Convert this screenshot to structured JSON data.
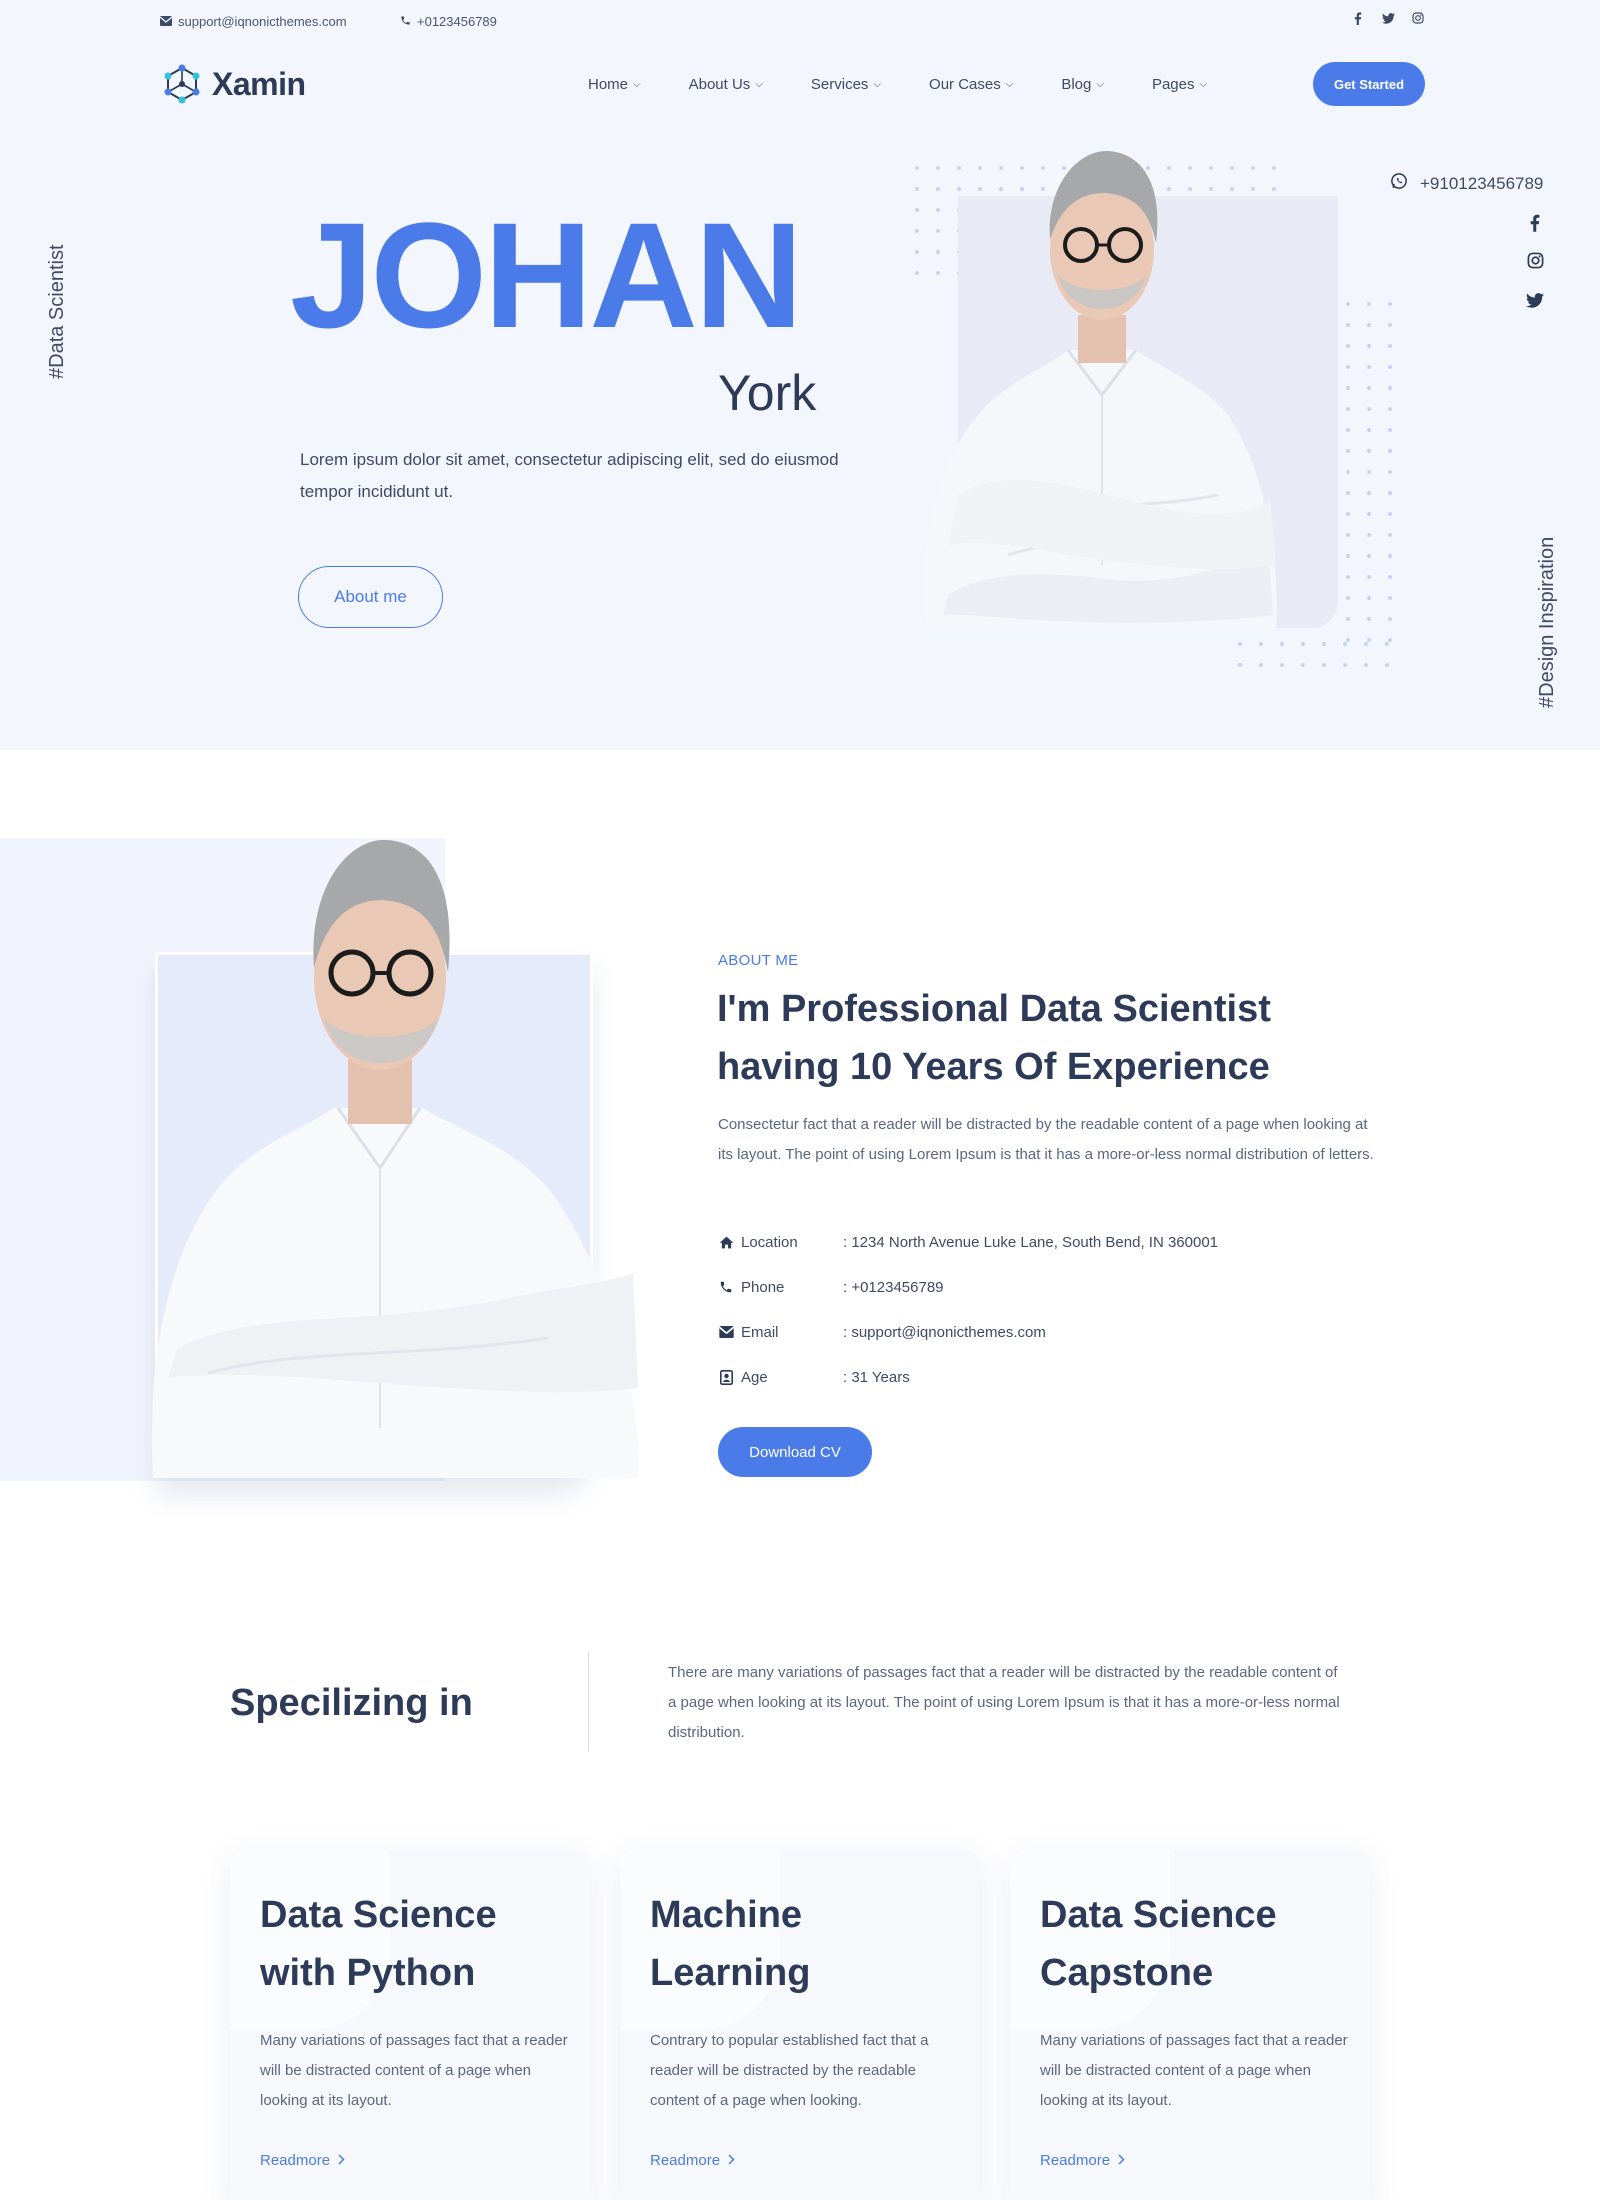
{
  "topbar": {
    "email": "support@iqnonicthemes.com",
    "phone": "+0123456789",
    "social_icons": [
      "facebook-icon",
      "twitter-icon",
      "instagram-icon"
    ]
  },
  "brand": {
    "name": "Xamin",
    "accent": "#4a7be9",
    "text": "#2d3a58"
  },
  "nav": {
    "items": [
      {
        "label": "Home"
      },
      {
        "label": "About Us"
      },
      {
        "label": "Services"
      },
      {
        "label": "Our Cases"
      },
      {
        "label": "Blog"
      },
      {
        "label": "Pages"
      }
    ],
    "cta": "Get Started"
  },
  "hero": {
    "side_left": "#Data Scientist",
    "side_right": "#Design Inspiration",
    "first_name": "JOHAN",
    "last_name": "York",
    "description": "Lorem ipsum dolor sit amet, consectetur adipiscing elit, sed do eiusmod tempor incididunt ut.",
    "button": "About me",
    "whatsapp": "+910123456789"
  },
  "about": {
    "eyebrow": "ABOUT ME",
    "title": "I'm Professional Data Scientist having 10 Years Of Experience",
    "description": "Consectetur fact that a reader will be distracted by the readable content of a page when looking at its layout. The point of using Lorem Ipsum is that it has a more-or-less normal distribution of letters.",
    "info": [
      {
        "label": "Location",
        "value": ": 1234 North Avenue Luke Lane, South Bend, IN 360001"
      },
      {
        "label": "Phone",
        "value": ": +0123456789"
      },
      {
        "label": "Email",
        "value": ": support@iqnonicthemes.com"
      },
      {
        "label": "Age",
        "value": ": 31 Years"
      }
    ],
    "button": "Download CV"
  },
  "specializing": {
    "title": "Specilizing in",
    "description": "There are many variations of passages fact that a reader will be distracted by the readable content of a page when looking at its layout. The point of using Lorem Ipsum is that it has a more-or-less normal distribution.",
    "cards": [
      {
        "title": "Data Science with Python",
        "description": "Many variations of passages fact that a reader will be distracted content of a page when looking at its layout.",
        "link": "Readmore"
      },
      {
        "title": "Machine Learning",
        "description": "Contrary to popular established fact that a reader will be distracted by the readable content of a page when looking.",
        "link": "Readmore"
      },
      {
        "title": "Data Science Capstone",
        "description": "Many variations of passages fact that a reader will be distracted content of a page when looking at its layout.",
        "link": "Readmore"
      }
    ]
  }
}
